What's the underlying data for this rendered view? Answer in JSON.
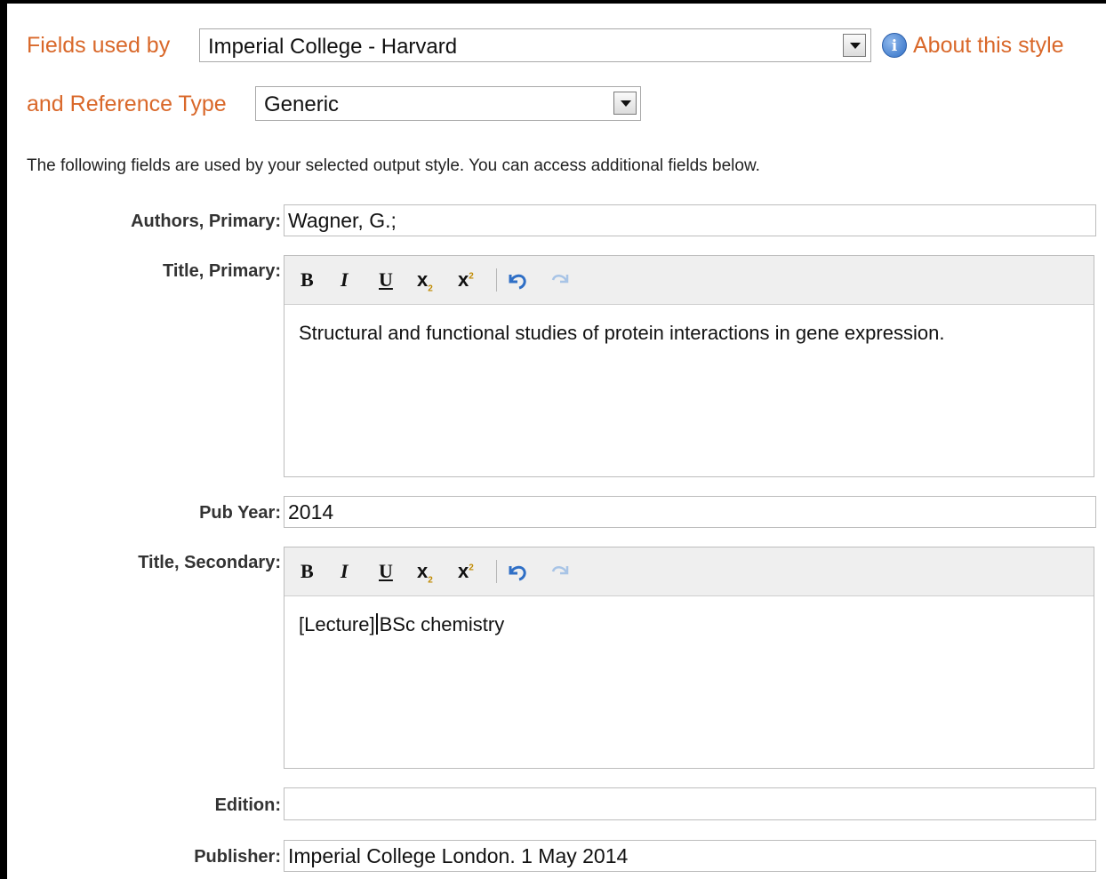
{
  "header": {
    "fields_used_by_label": "Fields used by",
    "style_select_value": "Imperial College - Harvard",
    "about_link": "About this style",
    "ref_type_label": "and Reference Type",
    "ref_type_select_value": "Generic",
    "intro_text": "The following fields are used by your selected output style. You can access additional fields below."
  },
  "fields": {
    "authors": {
      "label": "Authors, Primary:",
      "value": "Wagner, G.;"
    },
    "title_primary": {
      "label": "Title, Primary:",
      "value": "Structural and functional studies of protein interactions in gene expression."
    },
    "pub_year": {
      "label": "Pub Year:",
      "value": "2014"
    },
    "title_secondary": {
      "label": "Title, Secondary:",
      "value_before_caret": "[Lecture]",
      "value_after_caret": "BSc chemistry"
    },
    "edition": {
      "label": "Edition:",
      "value": ""
    },
    "publisher": {
      "label": "Publisher:",
      "value": "Imperial College London. 1 May 2014"
    }
  },
  "toolbar": {
    "bold": "B",
    "italic": "I",
    "underline": "U",
    "subscript": "x",
    "subscript_mark": "2",
    "superscript": "x",
    "superscript_mark": "2",
    "icons": [
      "bold-icon",
      "italic-icon",
      "underline-icon",
      "subscript-icon",
      "superscript-icon",
      "undo-icon",
      "redo-icon"
    ]
  },
  "colors": {
    "accent": "#d9682a",
    "info_icon": "#2f6fc6",
    "toolbar_bg": "#efefef"
  }
}
